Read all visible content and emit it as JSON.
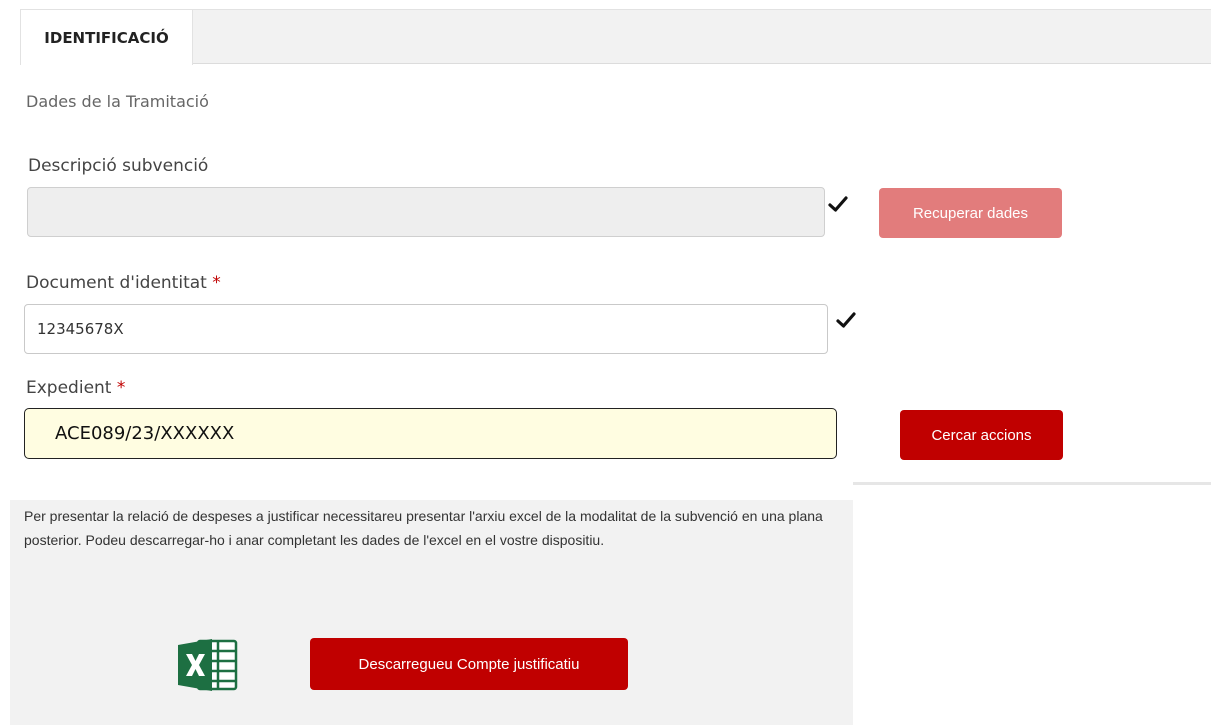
{
  "tabs": [
    {
      "label": "IDENTIFICACIÓ",
      "active": true
    }
  ],
  "section_title": "Dades de la Tramitació",
  "fields": {
    "descripcio": {
      "label": "Descripció subvenció",
      "value": "",
      "disabled": true,
      "button_label": "Recuperar dades"
    },
    "document": {
      "label": "Document d'identitat",
      "required_mark": "*",
      "value": "12345678X"
    },
    "expedient": {
      "label": "Expedient",
      "required_mark": "*",
      "value": "ACE089/23/XXXXXX",
      "button_label": "Cercar accions"
    }
  },
  "info": {
    "text": "Per presentar la relació de despeses a justificar necessitareu presentar l'arxiu excel de la modalitat de la subvenció en una plana posterior. Podeu descarregar-ho i anar completant les dades de l'excel en el vostre dispositiu.",
    "download_button_label": "Descarregueu Compte justificatiu",
    "icon": "excel-icon"
  },
  "colors": {
    "primary_red": "#c00000",
    "disabled_red": "#e27c7c",
    "highlight_bg": "#fffde1",
    "excel_green": "#1d6f42"
  }
}
